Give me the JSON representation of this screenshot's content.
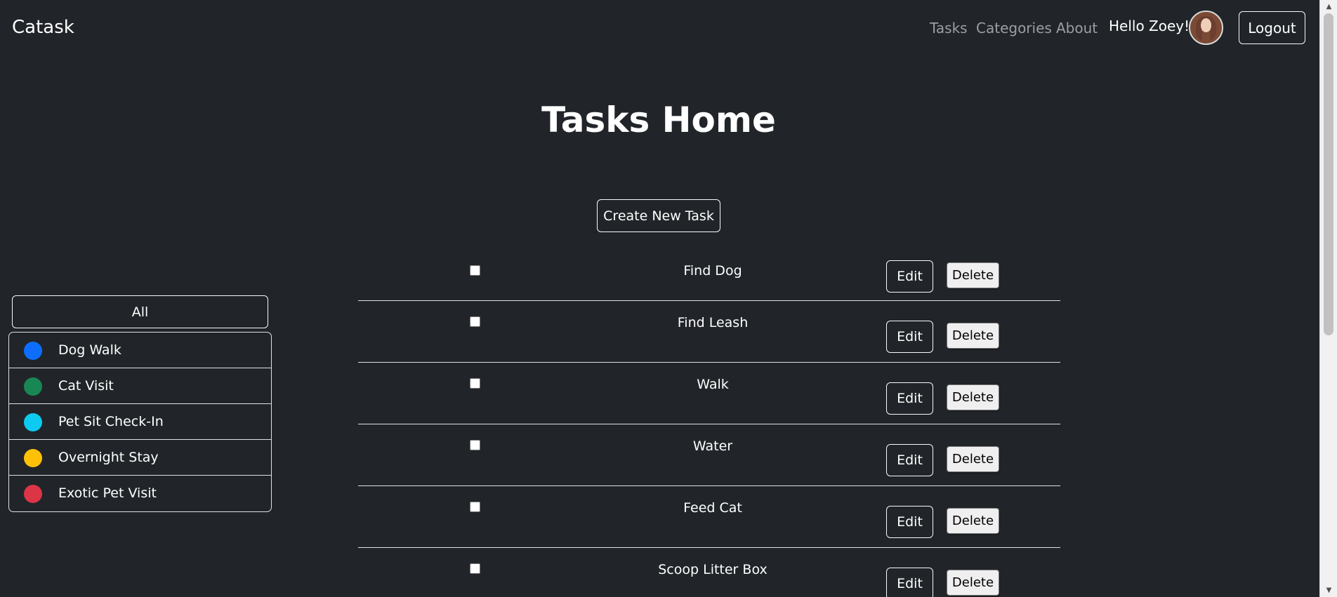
{
  "navbar": {
    "brand": "Catask",
    "links": [
      "Tasks",
      "Categories",
      "About"
    ],
    "greeting": "Hello Zoey!",
    "logout_label": "Logout"
  },
  "main": {
    "title": "Tasks Home",
    "create_label": "Create New Task"
  },
  "sidebar": {
    "all_label": "All",
    "categories": [
      {
        "label": "Dog Walk",
        "color": "#0d6efd"
      },
      {
        "label": "Cat Visit",
        "color": "#198754"
      },
      {
        "label": "Pet Sit Check-In",
        "color": "#0dcaf0"
      },
      {
        "label": "Overnight Stay",
        "color": "#ffc107"
      },
      {
        "label": "Exotic Pet Visit",
        "color": "#dc3545"
      }
    ]
  },
  "tasks": {
    "edit_label": "Edit",
    "delete_label": "Delete",
    "items": [
      {
        "name": "Find Dog",
        "checked": false
      },
      {
        "name": "Find Leash",
        "checked": false
      },
      {
        "name": "Walk",
        "checked": false
      },
      {
        "name": "Water",
        "checked": false
      },
      {
        "name": "Feed Cat",
        "checked": false
      },
      {
        "name": "Scoop Litter Box",
        "checked": false
      }
    ]
  },
  "colors": {
    "background": "#212529",
    "nav_link": "#9b9ea3"
  }
}
